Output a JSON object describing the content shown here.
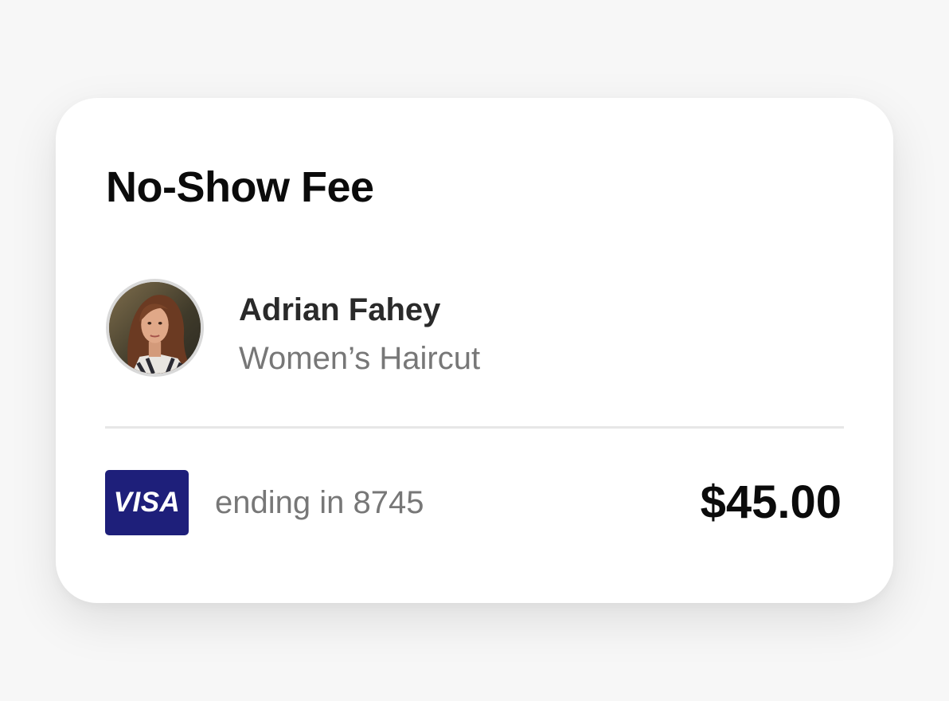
{
  "fee": {
    "title": "No-Show Fee",
    "amount": "$45.00"
  },
  "client": {
    "name": "Adrian Fahey",
    "service": "Women’s Haircut"
  },
  "payment": {
    "brand": "VISA",
    "ending": "ending in 8745"
  },
  "colors": {
    "visa_blue": "#1e1f7a",
    "text_dark": "#0b0b0b",
    "text_muted": "#777777"
  }
}
